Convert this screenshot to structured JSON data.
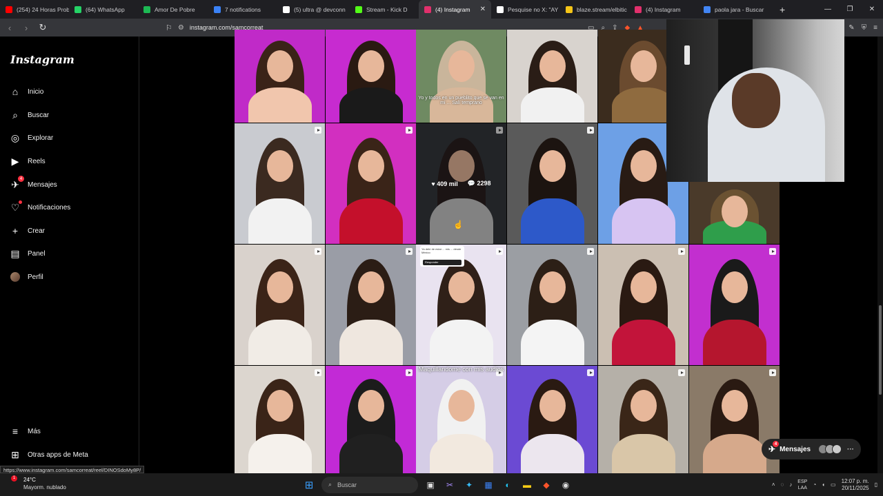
{
  "browser": {
    "tabs": [
      {
        "label": "(254) 24 Horas Prob",
        "color": "#ff0000"
      },
      {
        "label": "(64) WhatsApp",
        "color": "#25d366"
      },
      {
        "label": "Amor De Pobre",
        "color": "#1db954"
      },
      {
        "label": "7 notifications",
        "color": "#3b82f6"
      },
      {
        "label": "(5) ultra @ devconn",
        "color": "#ffffff"
      },
      {
        "label": "Stream - Kick D",
        "color": "#53fc18"
      },
      {
        "label": "(4) Instagram",
        "color": "#e1306c",
        "active": true
      },
      {
        "label": "Pesquise no X: \"AY G",
        "color": "#ffffff"
      },
      {
        "label": "blaze.stream/elbitic",
        "color": "#f5c518"
      },
      {
        "label": "(4) Instagram",
        "color": "#e1306c"
      },
      {
        "label": "paola jara - Buscar",
        "color": "#4285f4"
      }
    ],
    "url": "instagram.com/samcorreat"
  },
  "sidebar": {
    "logo": "Instagram",
    "items": [
      {
        "label": "Inicio",
        "icon": "home-icon",
        "glyph": "⌂"
      },
      {
        "label": "Buscar",
        "icon": "search-icon",
        "glyph": "⌕"
      },
      {
        "label": "Explorar",
        "icon": "compass-icon",
        "glyph": "◎"
      },
      {
        "label": "Reels",
        "icon": "reels-icon",
        "glyph": "▶"
      },
      {
        "label": "Mensajes",
        "icon": "messenger-icon",
        "glyph": "✈",
        "badge": "4"
      },
      {
        "label": "Notificaciones",
        "icon": "heart-icon",
        "glyph": "♡",
        "dot": true
      },
      {
        "label": "Crear",
        "icon": "plus-icon",
        "glyph": "+"
      },
      {
        "label": "Panel",
        "icon": "chart-icon",
        "glyph": "▤"
      },
      {
        "label": "Perfil",
        "icon": "avatar-icon",
        "glyph": ""
      }
    ],
    "more": "Más",
    "meta": "Otras apps de Meta"
  },
  "grid": {
    "hover_stats": {
      "likes": "409 mil",
      "comments": "2298"
    },
    "captions": {
      "car_caption": "Yo y todos en un pueblito que se van en mi ... Salí temprano",
      "makeup_caption": "Maquillandome con mis audios",
      "question_box": "Ya debí de estar ... mis ... desde México",
      "question_btn": "Responder"
    }
  },
  "floating": {
    "messages_label": "Mensajes",
    "messages_badge": "4"
  },
  "status_url": "https://www.instagram.com/samcorreat/reel/DINOSdoMy8P/",
  "taskbar": {
    "weather_temp": "24°C",
    "weather_desc": "Mayorm. nublado",
    "weather_badge": "1",
    "search_placeholder": "Buscar",
    "lang_top": "ESP",
    "lang_bottom": "LAA",
    "time": "12:07 p. m.",
    "date": "20/11/2025"
  }
}
